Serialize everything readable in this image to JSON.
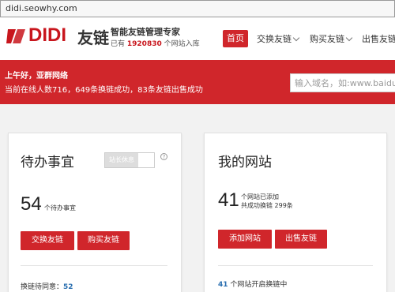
{
  "browser": {
    "url": "didi.seowhy.com"
  },
  "header": {
    "logo_text": "DIDI",
    "logo_cn": "友链",
    "slogan": "智能友链管理专家",
    "stats_prefix": "已有",
    "stats_count": "1920830",
    "stats_suffix": "个网站入库"
  },
  "nav": {
    "home": "首页",
    "items": [
      "交换友链",
      "购买友链",
      "出售友链"
    ]
  },
  "banner": {
    "greeting": "上午好，亚群网络",
    "online": "当前在线人数716，649条换链成功，83条友链出售成功",
    "search_placeholder": "输入域名，如:www.baidu.com"
  },
  "todo": {
    "title": "待办事宜",
    "toggle_label": "站长休息",
    "help": "?",
    "count": "54",
    "count_label": "个待办事宜",
    "btn_exchange": "交换友链",
    "btn_buy": "购买友链",
    "footer_label": "换链待同意：",
    "footer_value": "52"
  },
  "mysite": {
    "title": "我的网站",
    "count": "41",
    "line1": "个网站已添加",
    "line2": "共成功换链 299条",
    "btn_add": "添加网站",
    "btn_sell": "出售友链",
    "footer_value": "41",
    "footer_label": "个网站开启换链中"
  },
  "colors": {
    "brand_red": "#d0262b",
    "link_blue": "#2a6fb0"
  }
}
